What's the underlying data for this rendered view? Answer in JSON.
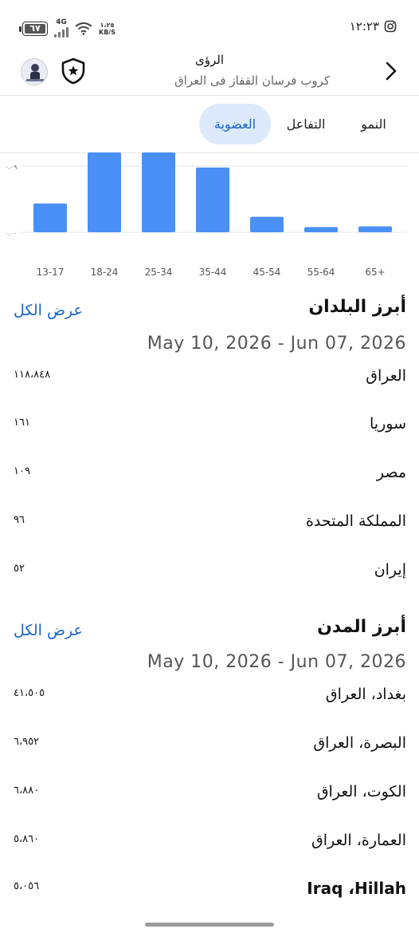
{
  "status_bar": {
    "time": "١٢:٢٣",
    "battery": "٦٧",
    "network": "4G",
    "speed_value": "١،٢٥",
    "speed_unit": "KB/S"
  },
  "header": {
    "title": "الرؤى",
    "subtitle": "كروب فرسان القفاز فى العراق"
  },
  "tabs": [
    {
      "label": "النمو",
      "active": false
    },
    {
      "label": "التفاعل",
      "active": false
    },
    {
      "label": "العضوية",
      "active": true
    }
  ],
  "chart_data": {
    "type": "bar",
    "categories": [
      "13-17",
      "18-24",
      "25-34",
      "35-44",
      "45-54",
      "55-64",
      "65+"
    ],
    "values": [
      0.039,
      0.13,
      0.13,
      0.088,
      0.021,
      0.007,
      0.008
    ],
    "yticks": [
      "٠،٠٩",
      "٠،٠٠"
    ],
    "ytick_values": [
      0.09,
      0.0
    ],
    "color": "#4a8ff5"
  },
  "top_countries": {
    "title": "أبرز البلدان",
    "see_all": "عرض الكل",
    "date_range": "May 10, 2026 - Jun 07, 2026",
    "rows": [
      {
        "name": "العراق",
        "value": "١١٨،٨٤٨"
      },
      {
        "name": "سوريا",
        "value": "١٦١"
      },
      {
        "name": "مصر",
        "value": "١٠٩"
      },
      {
        "name": "المملكة المتحدة",
        "value": "٩٦"
      },
      {
        "name": "إيران",
        "value": "٥٢"
      }
    ]
  },
  "top_cities": {
    "title": "أبرز المدن",
    "see_all": "عرض الكل",
    "date_range": "May 10, 2026 - Jun 07, 2026",
    "rows": [
      {
        "name": "بغداد، العراق",
        "value": "٤١،٥٠٥"
      },
      {
        "name": "البصرة، العراق",
        "value": "٦،٩٥٢"
      },
      {
        "name": "الكوت، العراق",
        "value": "٦،٨٨٠"
      },
      {
        "name": "العمارة، العراق",
        "value": "٥،٨٦٠"
      },
      {
        "name": "Iraq ،Hillah",
        "value": "٥،٠٥٦"
      }
    ]
  }
}
